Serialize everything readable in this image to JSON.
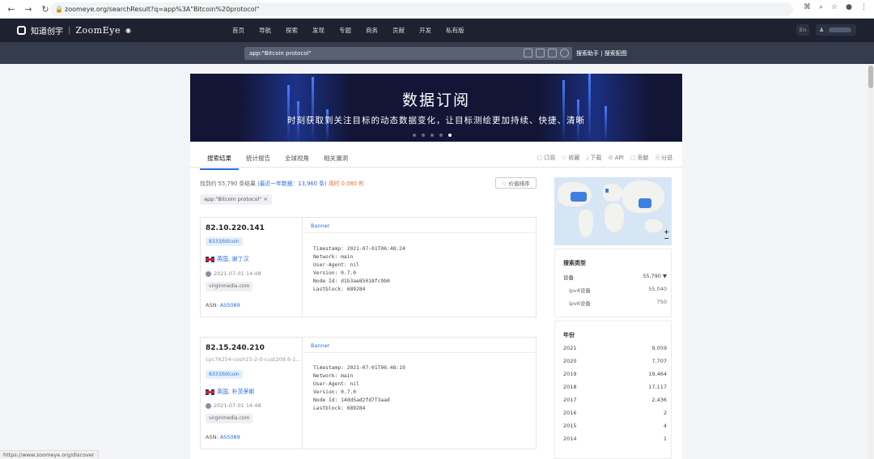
{
  "browser": {
    "url": "zoomeye.org/searchResult?q=app%3A\"Bitcoin%20protocol\"",
    "status_url": "https://www.zoomeye.org/discover"
  },
  "header": {
    "brand_cn": "知道创宇",
    "brand": "ZoomEye",
    "nav": [
      "首页",
      "导航",
      "探索",
      "发现",
      "专题",
      "商务",
      "贡献",
      "开发",
      "私有版"
    ],
    "lang": "En"
  },
  "search": {
    "query": "app:\"Bitcoin protocol\"",
    "help": "搜索助手 | 搜索配图"
  },
  "banner": {
    "title": "数据订阅",
    "subtitle": "时刻获取到关注目标的动态数据变化，让目标测绘更加持续、快捷、清晰"
  },
  "tabs": [
    "搜索结果",
    "统计报告",
    "全球视角",
    "相关漏洞"
  ],
  "actions": [
    "订阅",
    "收藏",
    "下载",
    "API",
    "贡献",
    "分说"
  ],
  "summary": {
    "prefix": "找到约 55,790 条结果",
    "recent": "(最近一年数据：13,960 条)",
    "time": "用时 0.080 秒"
  },
  "sort_label": "价值排序",
  "filter_tag": "app:\"Bitcoin protocol\"  ×",
  "results": [
    {
      "ip": "82.10.220.141",
      "host": "",
      "service": "8333/bitcoin",
      "location": "英国, 谢丁汉",
      "time": "2021-07-01 14:48",
      "isp": "virginmedia.com",
      "asn_label": "ASN:",
      "asn": "AS5089",
      "banner_label": "Banner",
      "banner": "Timestamp: 2021-07-01T06:48:24\nNetwork: main\nUser-Agent: nil\nVersion: 0.7.0\nNode Id: d1b3ae85018fc9b0\nLastblock: 689284"
    },
    {
      "ip": "82.15.240.210",
      "host": "cpc76254-cosh15-2-0-cust209.6-1...",
      "service": "8333/bitcoin",
      "location": "英国, 朴茨茅斯",
      "time": "2021-07-01 14:48",
      "isp": "virginmedia.com",
      "asn_label": "ASN:",
      "asn": "AS5089",
      "banner_label": "Banner",
      "banner": "Timestamp: 2021-07-01T06:48:19\nNetwork: main\nUser-Agent: nil\nVersion: 0.7.0\nNode Id: 14dd5ad2fd7T3aad\nLastblock: 689284"
    }
  ],
  "facets": {
    "type_title": "搜索类型",
    "types": [
      {
        "label": "设备",
        "value": "55,790 ▼"
      },
      {
        "label": "ipv4设备",
        "value": "55,040"
      },
      {
        "label": "ipv6设备",
        "value": "750"
      }
    ],
    "year_title": "年份",
    "years": [
      {
        "label": "2021",
        "value": "9,059"
      },
      {
        "label": "2020",
        "value": "7,707"
      },
      {
        "label": "2019",
        "value": "19,464"
      },
      {
        "label": "2018",
        "value": "17,117"
      },
      {
        "label": "2017",
        "value": "2,436"
      },
      {
        "label": "2016",
        "value": "2"
      },
      {
        "label": "2015",
        "value": "4"
      },
      {
        "label": "2014",
        "value": "1"
      }
    ]
  }
}
